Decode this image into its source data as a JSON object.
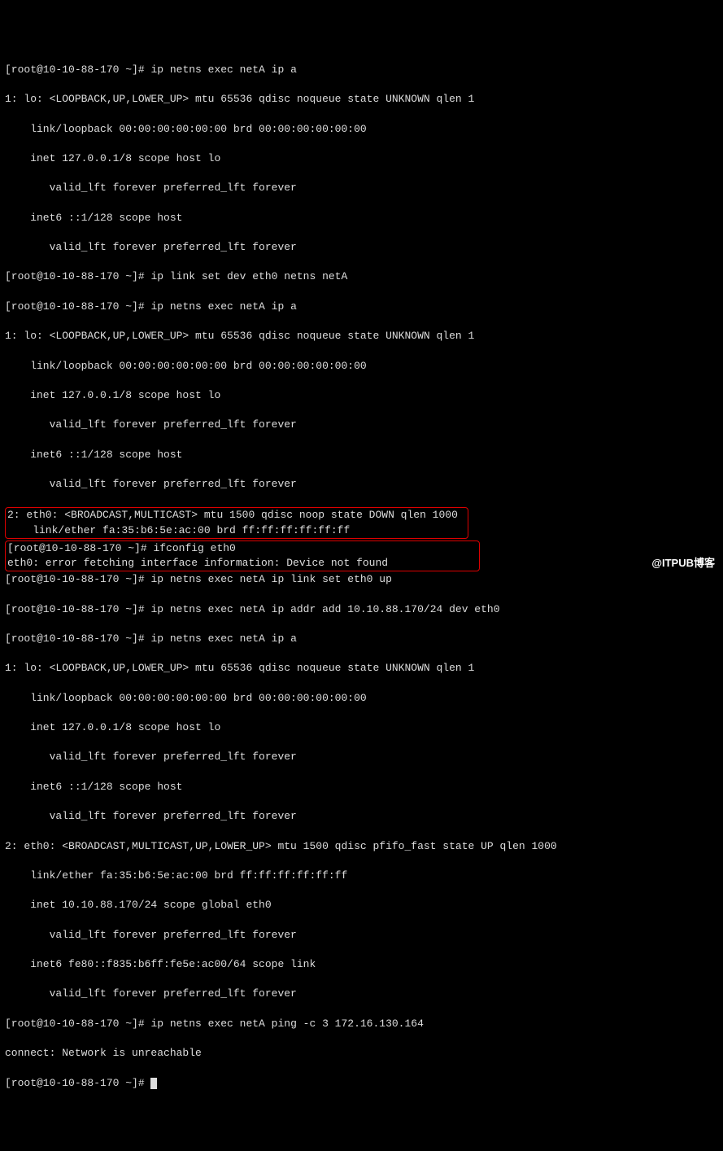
{
  "prompt": "[root@10-10-88-170 ~]# ",
  "cmd1": "ip netns exec netA ip a",
  "out1": {
    "l1": "1: lo: <LOOPBACK,UP,LOWER_UP> mtu 65536 qdisc noqueue state UNKNOWN qlen 1",
    "l2": "    link/loopback 00:00:00:00:00:00 brd 00:00:00:00:00:00",
    "l3": "    inet 127.0.0.1/8 scope host lo",
    "l4": "       valid_lft forever preferred_lft forever",
    "l5": "    inet6 ::1/128 scope host",
    "l6": "       valid_lft forever preferred_lft forever"
  },
  "cmd2": "ip link set dev eth0 netns netA",
  "cmd3": "ip netns exec netA ip a",
  "out3": {
    "l1": "1: lo: <LOOPBACK,UP,LOWER_UP> mtu 65536 qdisc noqueue state UNKNOWN qlen 1",
    "l2": "    link/loopback 00:00:00:00:00:00 brd 00:00:00:00:00:00",
    "l3": "    inet 127.0.0.1/8 scope host lo",
    "l4": "       valid_lft forever preferred_lft forever",
    "l5": "    inet6 ::1/128 scope host",
    "l6": "       valid_lft forever preferred_lft forever",
    "hl1": "2: eth0: <BROADCAST,MULTICAST> mtu 1500 qdisc noop state DOWN qlen 1000",
    "hl2": "    link/ether fa:35:b6:5e:ac:00 brd ff:ff:ff:ff:ff:ff"
  },
  "cmd4": "ifconfig eth0",
  "out4": "eth0: error fetching interface information: Device not found",
  "cmd5": "ip netns exec netA ip link set eth0 up",
  "cmd6": "ip netns exec netA ip addr add 10.10.88.170/24 dev eth0",
  "cmd7": "ip netns exec netA ip a",
  "out7": {
    "l1": "1: lo: <LOOPBACK,UP,LOWER_UP> mtu 65536 qdisc noqueue state UNKNOWN qlen 1",
    "l2": "    link/loopback 00:00:00:00:00:00 brd 00:00:00:00:00:00",
    "l3": "    inet 127.0.0.1/8 scope host lo",
    "l4": "       valid_lft forever preferred_lft forever",
    "l5": "    inet6 ::1/128 scope host",
    "l6": "       valid_lft forever preferred_lft forever",
    "l7": "2: eth0: <BROADCAST,MULTICAST,UP,LOWER_UP> mtu 1500 qdisc pfifo_fast state UP qlen 1000",
    "l8": "    link/ether fa:35:b6:5e:ac:00 brd ff:ff:ff:ff:ff:ff",
    "l9": "    inet 10.10.88.170/24 scope global eth0",
    "l10": "       valid_lft forever preferred_lft forever",
    "l11": "    inet6 fe80::f835:b6ff:fe5e:ac00/64 scope link",
    "l12": "       valid_lft forever preferred_lft forever"
  },
  "cmd8": "ip netns exec netA ping -c 3 172.16.130.164",
  "out8": "connect: Network is unreachable",
  "watermark": "@ITPUB博客"
}
